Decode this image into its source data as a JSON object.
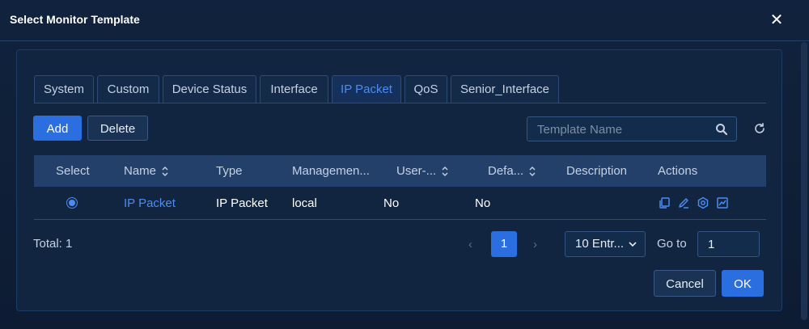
{
  "dialog": {
    "title": "Select Monitor Template"
  },
  "tabs": [
    {
      "label": "System",
      "active": false
    },
    {
      "label": "Custom",
      "active": false
    },
    {
      "label": "Device Status",
      "active": false
    },
    {
      "label": "Interface",
      "active": false
    },
    {
      "label": "IP Packet",
      "active": true
    },
    {
      "label": "QoS",
      "active": false
    },
    {
      "label": "Senior_Interface",
      "active": false
    }
  ],
  "toolbar": {
    "add_label": "Add",
    "delete_label": "Delete",
    "search_placeholder": "Template Name"
  },
  "table": {
    "columns": [
      "Select",
      "Name",
      "Type",
      "Managemen...",
      "User-...",
      "Defa...",
      "Description",
      "Actions"
    ],
    "rows": [
      {
        "selected": true,
        "name": "IP Packet",
        "type": "IP Packet",
        "management": "local",
        "user_defined": "No",
        "default": "No",
        "description": ""
      }
    ],
    "action_icons": [
      "copy-icon",
      "edit-icon",
      "settings-icon",
      "chart-icon"
    ]
  },
  "pagination": {
    "total": "Total: 1",
    "current_page": "1",
    "page_size": "10 Entr...",
    "goto_label": "Go to",
    "goto_value": "1"
  },
  "footer": {
    "cancel_label": "Cancel",
    "ok_label": "OK"
  },
  "colors": {
    "accent": "#2a6ee0",
    "link": "#4c8cf0",
    "background": "#0f2038",
    "header_row": "#22406a"
  }
}
